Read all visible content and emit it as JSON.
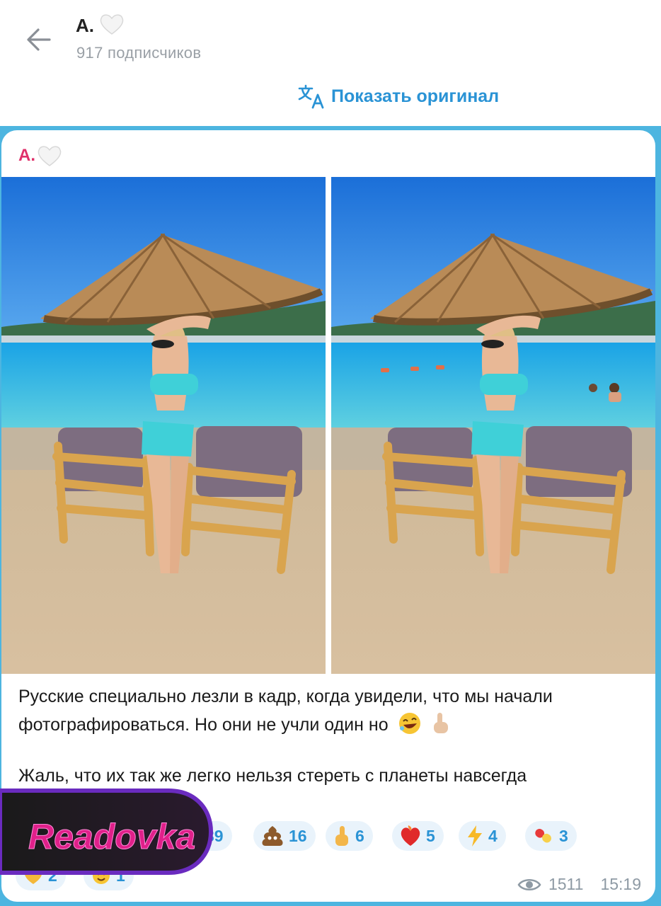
{
  "header": {
    "channel_name": "А.",
    "subscribers": "917 подписчиков",
    "translate_label": "Показать оригинал"
  },
  "post": {
    "author": "А.",
    "text_line1": "Русские специально лезли в кадр, когда увидели, что мы начали",
    "text_line2": "фотографироваться. Но они не учли один но",
    "text_line3": "Жаль, что их так же легко нельзя стереть с планеты навсегда",
    "views": "1511",
    "time": "15:19"
  },
  "reactions": [
    {
      "icon": "clown-emoji-icon",
      "count": "39"
    },
    {
      "icon": "poop-emoji-icon",
      "count": "16"
    },
    {
      "icon": "middle-finger-emoji-icon",
      "count": "6"
    },
    {
      "icon": "heart-on-fire-emoji-icon",
      "count": "5"
    },
    {
      "icon": "lightning-emoji-icon",
      "count": "4"
    },
    {
      "icon": "pill-emoji-icon",
      "count": "3"
    },
    {
      "icon": "heart-emoji-icon",
      "count": "2"
    },
    {
      "icon": "love-face-emoji-icon",
      "count": "1"
    }
  ],
  "watermark": {
    "logo_text": "Readovka"
  },
  "colors": {
    "accent": "#2a93d5",
    "author": "#e0306a",
    "chat_background": "#4db5e0",
    "reaction_background": "#e9f3fb",
    "logo_pink": "#e0208a",
    "logo_purple": "#6a2bbf"
  }
}
